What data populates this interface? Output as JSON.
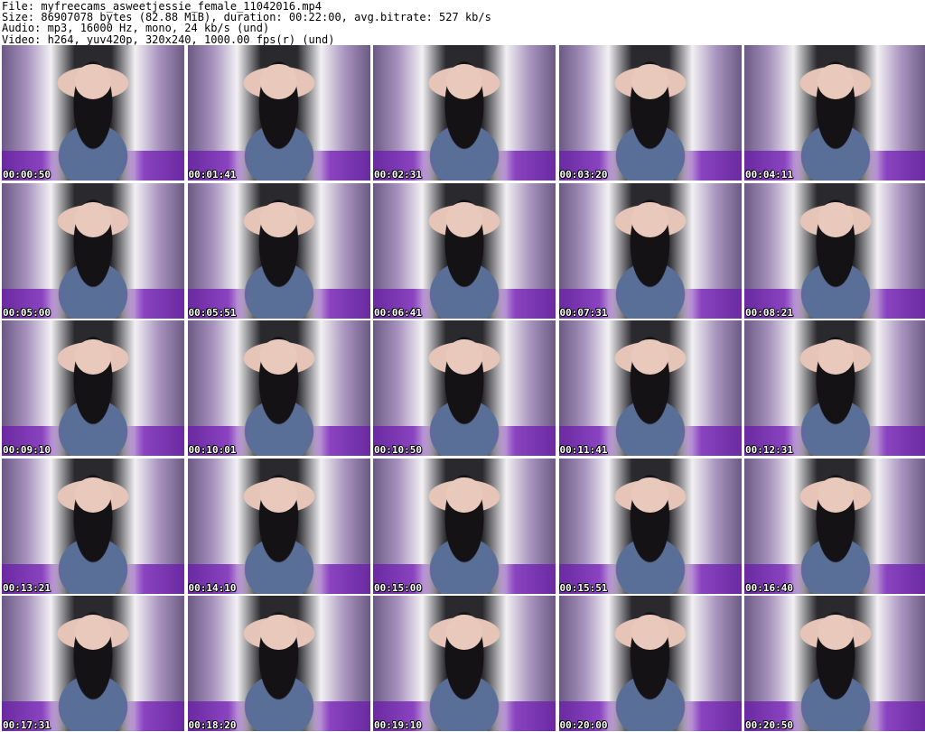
{
  "header": {
    "file": "File: myfreecams_asweetjessie_female_11042016.mp4",
    "size": "Size: 86907078 bytes (82.88 MiB), duration: 00:22:00, avg.bitrate: 527 kb/s",
    "audio": "Audio: mp3, 16000 Hz, mono, 24 kb/s (und)",
    "video": "Video: h264, yuv420p, 320x240, 1000.00 fps(r) (und)"
  },
  "thumbnails": [
    {
      "time": "00:00:50"
    },
    {
      "time": "00:01:41"
    },
    {
      "time": "00:02:31"
    },
    {
      "time": "00:03:20"
    },
    {
      "time": "00:04:11"
    },
    {
      "time": "00:05:00"
    },
    {
      "time": "00:05:51"
    },
    {
      "time": "00:06:41"
    },
    {
      "time": "00:07:31"
    },
    {
      "time": "00:08:21"
    },
    {
      "time": "00:09:10"
    },
    {
      "time": "00:10:01"
    },
    {
      "time": "00:10:50"
    },
    {
      "time": "00:11:41"
    },
    {
      "time": "00:12:31"
    },
    {
      "time": "00:13:21"
    },
    {
      "time": "00:14:10"
    },
    {
      "time": "00:15:00"
    },
    {
      "time": "00:15:51"
    },
    {
      "time": "00:16:40"
    },
    {
      "time": "00:17:31"
    },
    {
      "time": "00:18:20"
    },
    {
      "time": "00:19:10"
    },
    {
      "time": "00:20:00"
    },
    {
      "time": "00:20:50"
    }
  ]
}
